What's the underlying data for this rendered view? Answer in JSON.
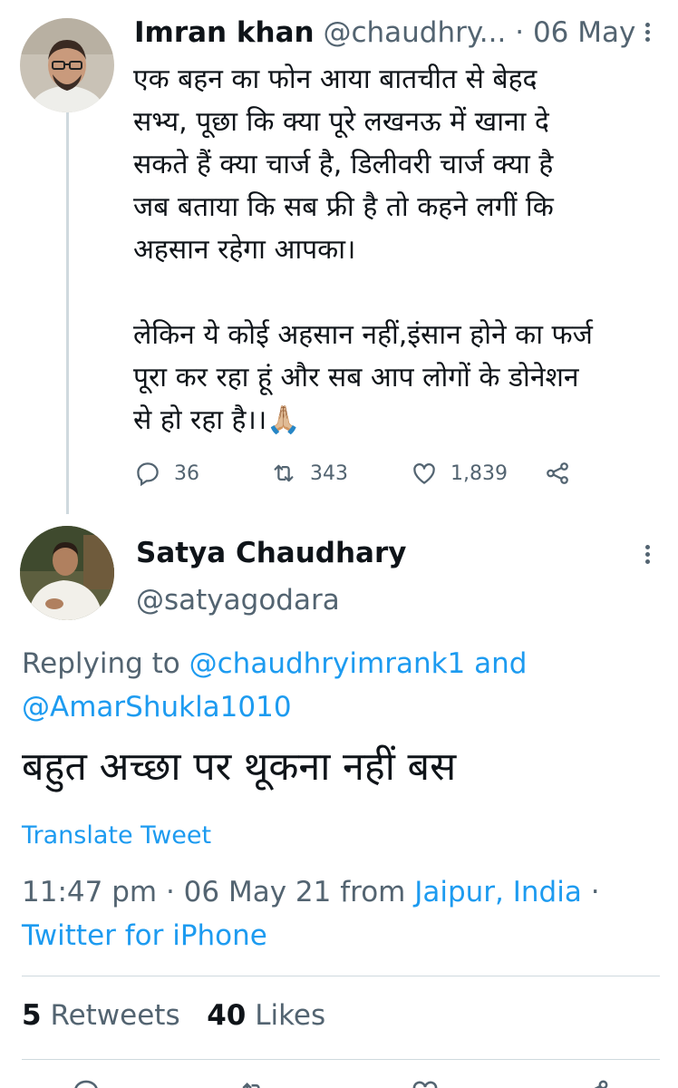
{
  "parent_tweet": {
    "author_name": "Imran khan",
    "author_handle": "@chaudhry...",
    "separator": "·",
    "date": "06 May",
    "text_lines": [
      "एक बहन का फोन आया बातचीत से बेहद",
      "सभ्य, पूछा कि क्या पूरे लखनऊ में खाना दे",
      "सकते हैं क्या चार्ज है, डिलीवरी चार्ज क्या है",
      "जब बताया कि सब फ्री है तो कहने लगीं कि",
      "अहसान रहेगा आपका।",
      "",
      "लेकिन ये कोई अहसान नहीं,इंसान होने का फर्ज",
      "पूरा कर रहा हूं और सब आप लोगों के डोनेशन",
      "से हो रहा है।।🙏🏼"
    ],
    "reply_count": "36",
    "retweet_count": "343",
    "like_count": "1,839"
  },
  "reply_tweet": {
    "author_name": "Satya Chaudhary",
    "author_handle": "@satyagodara",
    "replying_prefix": "Replying to",
    "replying_user_1": "@chaudhryimrank1",
    "replying_and": "and",
    "replying_user_2": "@AmarShukla1010",
    "text": "बहुत अच्छा पर थूकना नहीं बस",
    "translate_label": "Translate Tweet",
    "time": "11:47 pm",
    "separator": "·",
    "date": "06 May 21",
    "from_label": "from",
    "location": "Jaipur, India",
    "source": "Twitter for iPhone",
    "retweets_count": "5",
    "retweets_label": "Retweets",
    "likes_count": "40",
    "likes_label": "Likes"
  },
  "colors": {
    "link": "#1d9bf0",
    "secondary_text": "#536471",
    "primary_text": "#0f1419",
    "divider": "#cfd9de"
  },
  "icons": [
    "reply-icon",
    "retweet-icon",
    "like-icon",
    "share-icon",
    "more-icon"
  ]
}
